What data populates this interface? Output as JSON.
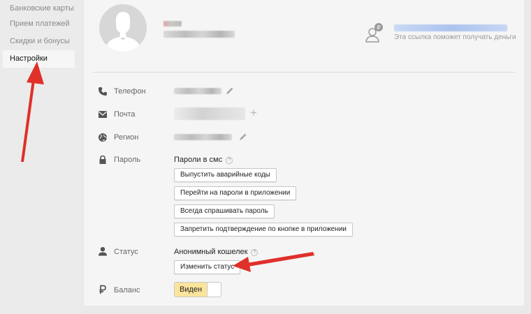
{
  "sidebar": {
    "items": [
      {
        "label": "Банковские карты"
      },
      {
        "label": "Прием платежей"
      },
      {
        "label": "Скидки и бонусы"
      },
      {
        "label": "Настройки",
        "active": true
      }
    ]
  },
  "profile": {
    "promo_text": "Эта ссылка поможет получать деньги"
  },
  "fields": {
    "phone": {
      "label": "Телефон"
    },
    "email": {
      "label": "Почта"
    },
    "region": {
      "label": "Регион"
    },
    "password": {
      "label": "Пароль",
      "sms_text": "Пароли в смс",
      "help": "?",
      "buttons": [
        "Выпустить аварийные коды",
        "Перейти на пароли в приложении",
        "Всегда спрашивать пароль",
        "Запретить подтверждение по кнопке в приложении"
      ]
    },
    "status": {
      "label": "Статус",
      "value": "Анонимный кошелек",
      "help": "?",
      "change_button": "Изменить статус"
    },
    "balance": {
      "label": "Баланс",
      "toggle_label": "Виден"
    }
  },
  "colors": {
    "annotation_arrow": "#e0302a",
    "toggle_on": "#fbe49b",
    "promo_link": "#abc3ee"
  },
  "icons": [
    "phone-icon",
    "mail-icon",
    "globe-icon",
    "lock-icon",
    "person-icon",
    "ruble-icon",
    "pencil-icon",
    "plus-icon",
    "question-icon",
    "referral-icon"
  ]
}
